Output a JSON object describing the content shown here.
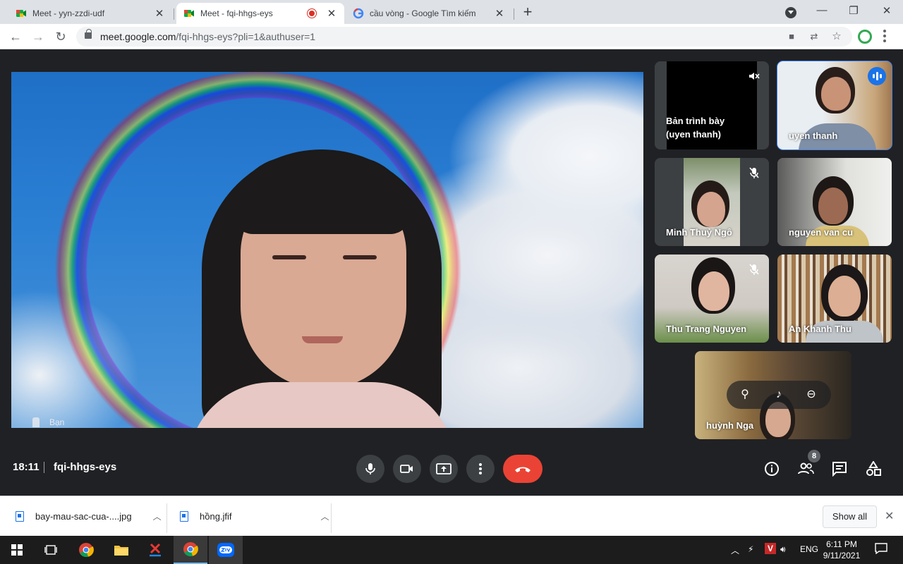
{
  "browser": {
    "tabs": [
      {
        "title": "Meet - yyn-zzdi-udf",
        "active": false
      },
      {
        "title": "Meet - fqi-hhgs-eys",
        "active": true,
        "recording": true
      },
      {
        "title": "cầu vòng - Google Tìm kiếm",
        "active": false
      }
    ],
    "url_host": "meet.google.com",
    "url_path": "/fqi-hhgs-eys?pli=1&authuser=1"
  },
  "meet": {
    "main_label": "Bạn",
    "participants": [
      {
        "name": "Bản trình bày\n(uyen thanh)",
        "muted": true
      },
      {
        "name": "uyen thanh",
        "speaking": true
      },
      {
        "name": "Minh Thuỷ Ngô",
        "muted": true
      },
      {
        "name": "nguyen van cu",
        "muted": false
      },
      {
        "name": "Thu Trang Nguyen",
        "muted": true
      },
      {
        "name": "An Khanh Thu",
        "muted": false
      },
      {
        "name": "huỳnh Nga",
        "muted": false
      }
    ],
    "time": "18:11",
    "meeting_code": "fqi-hhgs-eys",
    "people_count": "8"
  },
  "downloads": {
    "items": [
      {
        "name": "bay-mau-sac-cua-....jpg"
      },
      {
        "name": "hồng.jfif"
      }
    ],
    "show_all": "Show all"
  },
  "taskbar": {
    "lang": "ENG",
    "time": "6:11 PM",
    "date": "9/11/2021"
  },
  "colors": {
    "meet_bg": "#202124",
    "end_call": "#ea4335",
    "speaking": "#4285f4"
  }
}
